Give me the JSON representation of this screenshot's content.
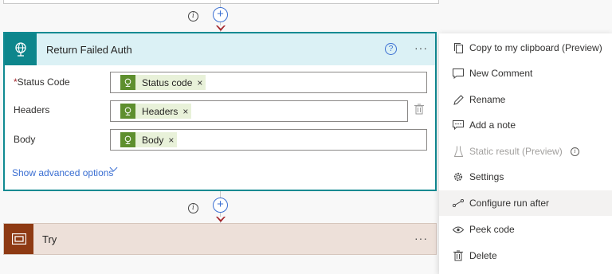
{
  "action_card": {
    "title": "Return Failed Auth",
    "fields": [
      {
        "label": "Status Code",
        "required": true,
        "token": "Status code"
      },
      {
        "label": "Headers",
        "required": false,
        "token": "Headers"
      },
      {
        "label": "Body",
        "required": false,
        "token": "Body"
      }
    ],
    "required_marker": "*",
    "token_remove": "×",
    "advanced_options": "Show advanced options",
    "more": "···",
    "help": "?"
  },
  "try_card": {
    "title": "Try",
    "more": "···"
  },
  "connector": {
    "info": "i",
    "add": "+"
  },
  "context_menu": {
    "items": [
      {
        "label": "Copy to my clipboard (Preview)",
        "icon": "copy-icon"
      },
      {
        "label": "New Comment",
        "icon": "comment-icon"
      },
      {
        "label": "Rename",
        "icon": "pencil-icon"
      },
      {
        "label": "Add a note",
        "icon": "note-icon"
      },
      {
        "label": "Static result (Preview)",
        "icon": "flask-icon",
        "disabled": true,
        "info": "i"
      },
      {
        "label": "Settings",
        "icon": "gear-icon"
      },
      {
        "label": "Configure run after",
        "icon": "run-after-icon",
        "highlighted": true
      },
      {
        "label": "Peek code",
        "icon": "eye-icon"
      },
      {
        "label": "Delete",
        "icon": "trash-icon"
      }
    ]
  },
  "colors": {
    "accent": "#108a92",
    "header_bg": "#dbf1f5",
    "token_bg": "#e8f1d9",
    "token_icon": "#5e8f2e",
    "try_bg": "#ede0d9",
    "try_icon": "#8e3a13",
    "link": "#3b6fd2",
    "arrow": "#a4262c"
  }
}
